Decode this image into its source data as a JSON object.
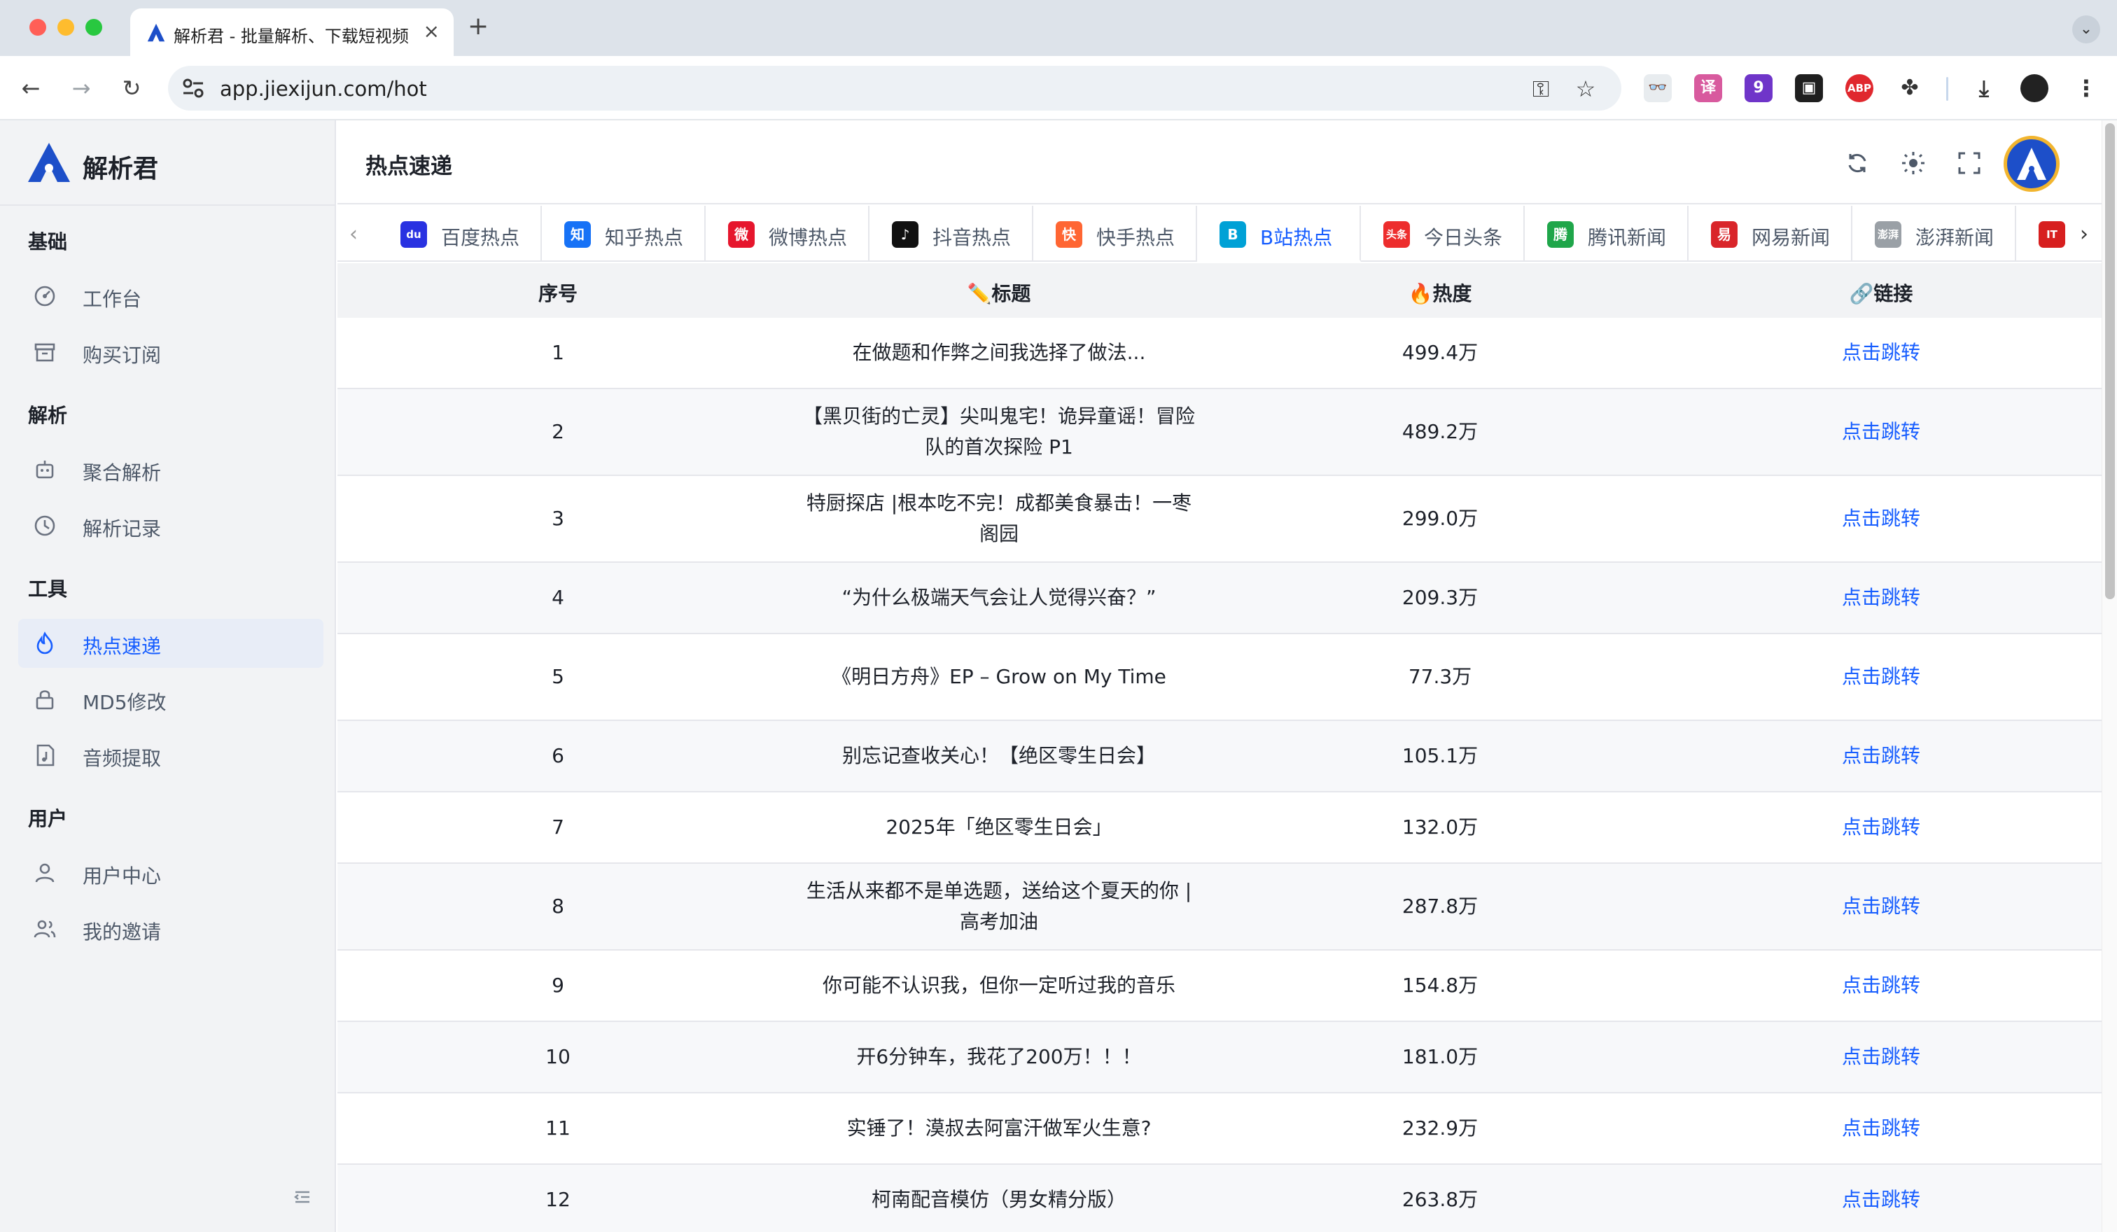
{
  "browser": {
    "tab_title": "解析君 - 批量解析、下载短视频",
    "url": "app.jiexijun.com/hot",
    "close_glyph": "×",
    "new_tab_glyph": "+",
    "extensions": [
      {
        "name": "tampermonkey-ext-icon",
        "text": "👓",
        "color": "#e8ecef"
      },
      {
        "name": "translate-ext-icon",
        "text": "译",
        "color": "#d85a9e"
      },
      {
        "name": "badge-ext-icon",
        "text": "9",
        "color": "#6f35c9"
      },
      {
        "name": "dashboard-ext-icon",
        "text": "▣",
        "color": "#1f1f1f"
      },
      {
        "name": "adblock-plus-icon",
        "text": "ABP",
        "color": "#e0282e"
      },
      {
        "name": "extensions-puzzle-icon",
        "text": "✤",
        "color": "#ffffff"
      }
    ]
  },
  "app": {
    "name": "解析君",
    "page_title": "热点速递"
  },
  "sidebar": {
    "groups": [
      {
        "label": "基础",
        "items": [
          {
            "label": "工作台",
            "icon": "dashboard-icon"
          },
          {
            "label": "购买订阅",
            "icon": "archive-box-icon"
          }
        ]
      },
      {
        "label": "解析",
        "items": [
          {
            "label": "聚合解析",
            "icon": "robot-icon"
          },
          {
            "label": "解析记录",
            "icon": "history-icon"
          }
        ]
      },
      {
        "label": "工具",
        "items": [
          {
            "label": "热点速递",
            "icon": "fire-icon",
            "active": true
          },
          {
            "label": "MD5修改",
            "icon": "lock-icon"
          },
          {
            "label": "音频提取",
            "icon": "music-file-icon"
          }
        ]
      },
      {
        "label": "用户",
        "items": [
          {
            "label": "用户中心",
            "icon": "user-icon"
          },
          {
            "label": "我的邀请",
            "icon": "users-icon"
          }
        ]
      }
    ]
  },
  "platform_tabs": [
    {
      "label": "百度热点",
      "icon_text": "du",
      "color": "#2932e1"
    },
    {
      "label": "知乎热点",
      "icon_text": "知",
      "color": "#1772f6"
    },
    {
      "label": "微博热点",
      "icon_text": "微",
      "color": "#e6162d"
    },
    {
      "label": "抖音热点",
      "icon_text": "♪",
      "color": "#111111"
    },
    {
      "label": "快手热点",
      "icon_text": "快",
      "color": "#ff6633"
    },
    {
      "label": "B站热点",
      "icon_text": "B",
      "color": "#00a1d6",
      "active": true
    },
    {
      "label": "今日头条",
      "icon_text": "头条",
      "color": "#ed2d2d"
    },
    {
      "label": "腾讯新闻",
      "icon_text": "腾",
      "color": "#1fa64a"
    },
    {
      "label": "网易新闻",
      "icon_text": "易",
      "color": "#d9252a"
    },
    {
      "label": "澎湃新闻",
      "icon_text": "澎湃",
      "color": "#9aa0a6"
    },
    {
      "label": "IT",
      "icon_text": "IT",
      "color": "#d71f1f"
    }
  ],
  "table": {
    "headers": {
      "index": "序号",
      "title": "✏️标题",
      "hot": "🔥热度",
      "link": "🔗链接"
    },
    "rows": [
      {
        "index": "1",
        "title": "在做题和作弊之间我选择了做法...",
        "hot": "499.4万",
        "link": "点击跳转"
      },
      {
        "index": "2",
        "title": "【黑贝街的亡灵】尖叫鬼宅！诡异童谣！冒险队的首次探险 P1",
        "hot": "489.2万",
        "link": "点击跳转"
      },
      {
        "index": "3",
        "title": "特厨探店 |根本吃不完！成都美食暴击！一枣阁园",
        "hot": "299.0万",
        "link": "点击跳转"
      },
      {
        "index": "4",
        "title": "“为什么极端天气会让人觉得兴奋？”",
        "hot": "209.3万",
        "link": "点击跳转"
      },
      {
        "index": "5",
        "title": "《明日方舟》EP – Grow on My Time",
        "hot": "77.3万",
        "link": "点击跳转"
      },
      {
        "index": "6",
        "title": "别忘记查收关心！【绝区零生日会】",
        "hot": "105.1万",
        "link": "点击跳转"
      },
      {
        "index": "7",
        "title": "2025年「绝区零生日会」",
        "hot": "132.0万",
        "link": "点击跳转"
      },
      {
        "index": "8",
        "title": "生活从来都不是单选题，送给这个夏天的你 | 高考加油",
        "hot": "287.8万",
        "link": "点击跳转"
      },
      {
        "index": "9",
        "title": "你可能不认识我，但你一定听过我的音乐",
        "hot": "154.8万",
        "link": "点击跳转"
      },
      {
        "index": "10",
        "title": "开6分钟车，我花了200万！！！",
        "hot": "181.0万",
        "link": "点击跳转"
      },
      {
        "index": "11",
        "title": "实锤了！漠叔去阿富汗做军火生意?",
        "hot": "232.9万",
        "link": "点击跳转"
      },
      {
        "index": "12",
        "title": "柯南配音模仿（男女精分版）",
        "hot": "263.8万",
        "link": "点击跳转"
      }
    ]
  },
  "colors": {
    "accent": "#165dff",
    "sidebar_bg": "#f2f3f5",
    "active_bg": "#e8edf7"
  }
}
